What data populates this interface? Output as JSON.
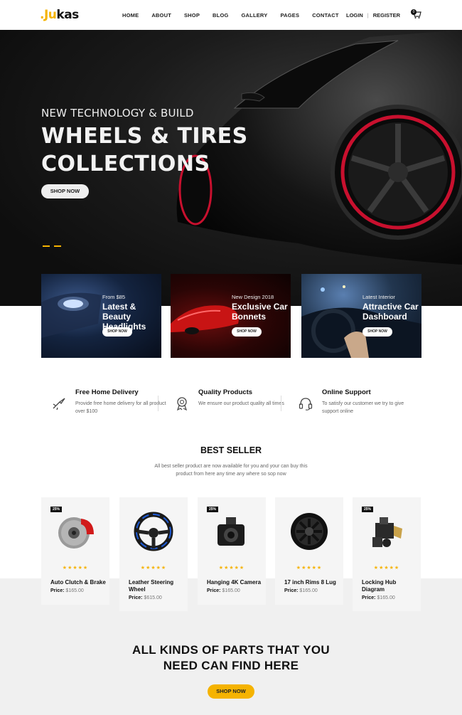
{
  "header": {
    "logo_text": "Jukas",
    "nav": [
      "HOME",
      "ABOUT",
      "SHOP",
      "BLOG",
      "GALLERY",
      "PAGES",
      "CONTACT"
    ],
    "login": "LOGIN",
    "register": "REGISTER",
    "cart_count": "0"
  },
  "hero": {
    "subtitle": "NEW TECHNOLOGY & BUILD",
    "title_line1": "WHEELS & TIRES",
    "title_line2": "COLLECTIONS",
    "button": "SHOP NOW"
  },
  "banners": [
    {
      "pre": "From $85",
      "title_line1": "Latest & Beauty",
      "title_line2": "Headlights",
      "button": "SHOP NOW"
    },
    {
      "pre": "New Design 2018",
      "title_line1": "Exclusive Car",
      "title_line2": "Bonnets",
      "button": "SHOP NOW"
    },
    {
      "pre": "Latest Interior",
      "title_line1": "Attractive Car",
      "title_line2": "Dashboard",
      "button": "SHOP NOW"
    }
  ],
  "features": [
    {
      "title": "Free Home Delivery",
      "desc": "Provide free home delivery for all product over $100",
      "icon": "delivery-icon"
    },
    {
      "title": "Quality Products",
      "desc": "We ensure our product quality all times",
      "icon": "badge-icon"
    },
    {
      "title": "Online Support",
      "desc": "To satisfy our customer we try to give support online",
      "icon": "headset-icon"
    }
  ],
  "best_seller": {
    "title": "BEST SELLER",
    "desc": "All best seller product are now available for you and your can buy this product from here any time any where so sop now"
  },
  "products": [
    {
      "badge": "25%",
      "name": "Auto Clutch & Brake",
      "price_label": "Price:",
      "price": "$165.00",
      "stars": "★★★★★"
    },
    {
      "badge": "",
      "name": "Leather Steering Wheel",
      "price_label": "Price:",
      "price": "$615.00",
      "stars": "★★★★★"
    },
    {
      "badge": "25%",
      "name": "Hanging 4K Camera",
      "price_label": "Price:",
      "price": "$165.00",
      "stars": "★★★★★"
    },
    {
      "badge": "",
      "name": "17 inch Rims 8 Lug",
      "price_label": "Price:",
      "price": "$165.00",
      "stars": "★★★★★"
    },
    {
      "badge": "25%",
      "name": "Locking Hub Diagram",
      "price_label": "Price:",
      "price": "$165.00",
      "stars": "★★★★★"
    }
  ],
  "promo": {
    "line1": "ALL KINDS OF PARTS THAT YOU",
    "line2": "NEED CAN FIND HERE",
    "button": "SHOP NOW"
  },
  "colors": {
    "accent": "#f5b301",
    "dark": "#111111",
    "light_bg": "#f0f0f0"
  }
}
